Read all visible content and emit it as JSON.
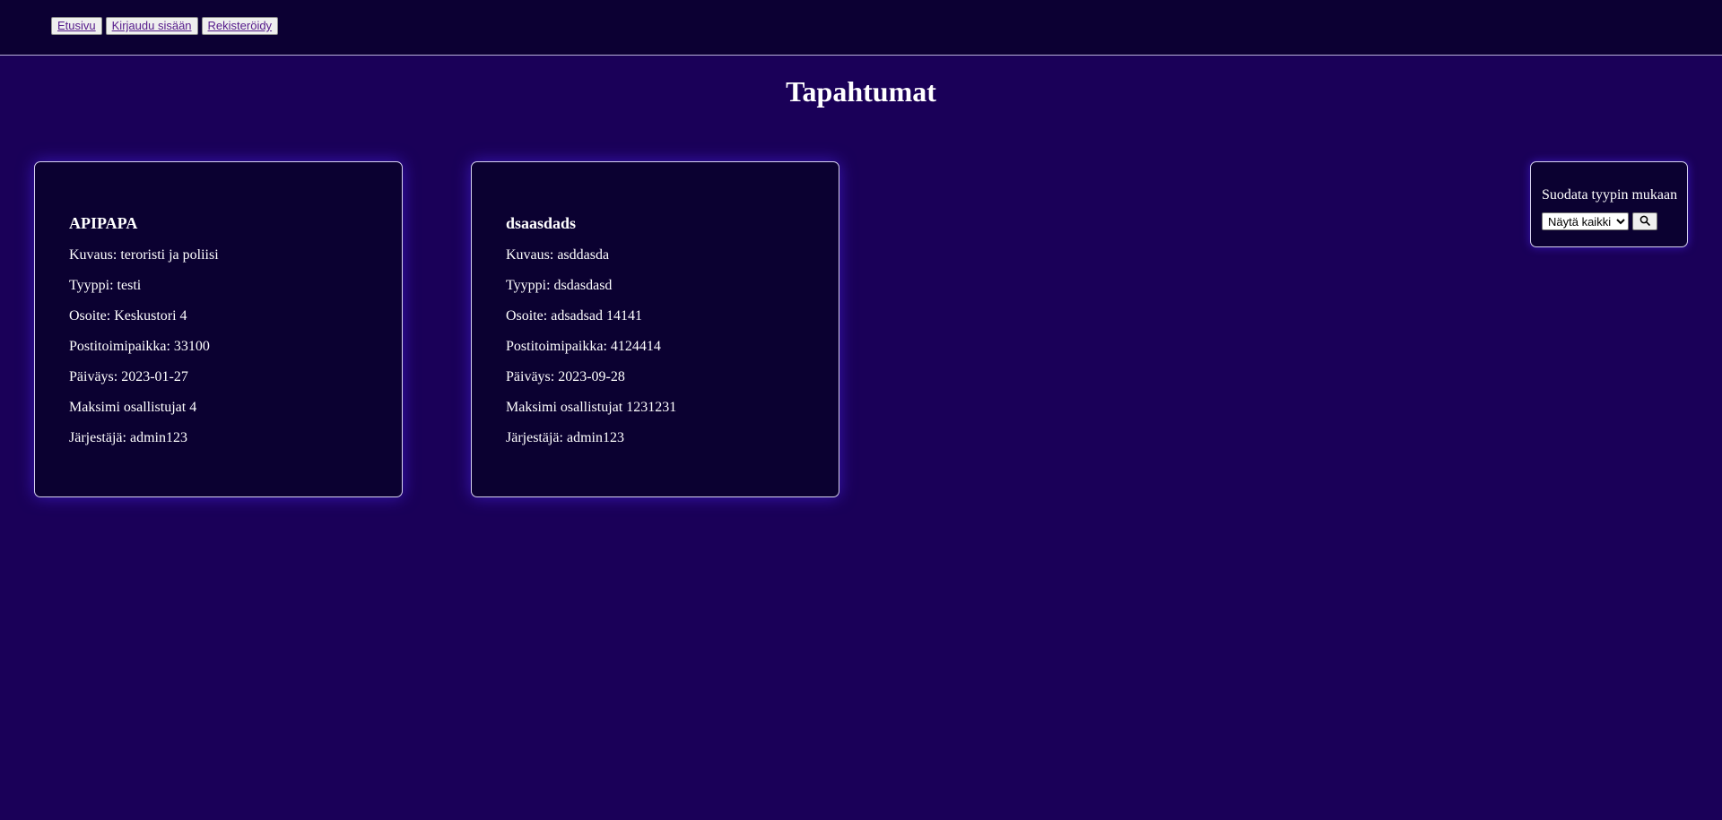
{
  "nav": {
    "items": [
      {
        "label": "Etusivu"
      },
      {
        "label": "Kirjaudu sisään"
      },
      {
        "label": "Rekisteröidy"
      }
    ]
  },
  "page": {
    "title": "Tapahtumat"
  },
  "events": [
    {
      "name": "APIPAPA",
      "description": "Kuvaus: teroristi ja poliisi",
      "type": "Tyyppi: testi",
      "address": "Osoite: Keskustori 4",
      "postal": "Postitoimipaikka: 33100",
      "date": "Päiväys: 2023-01-27",
      "max": "Maksimi osallistujat 4",
      "organizer": "Järjestäjä: admin123"
    },
    {
      "name": "dsaasdads",
      "description": "Kuvaus: asddasda",
      "type": "Tyyppi: dsdasdasd",
      "address": "Osoite: adsadsad 14141",
      "postal": "Postitoimipaikka: 4124414",
      "date": "Päiväys: 2023-09-28",
      "max": "Maksimi osallistujat 1231231",
      "organizer": "Järjestäjä: admin123"
    }
  ],
  "filter": {
    "label": "Suodata tyypin mukaan",
    "selected": "Näytä kaikki",
    "search_icon": "search-icon"
  },
  "colors": {
    "background": "#1a0058",
    "topbar": "#0c0033",
    "card": "#0b0131",
    "link": "#551a8b"
  }
}
